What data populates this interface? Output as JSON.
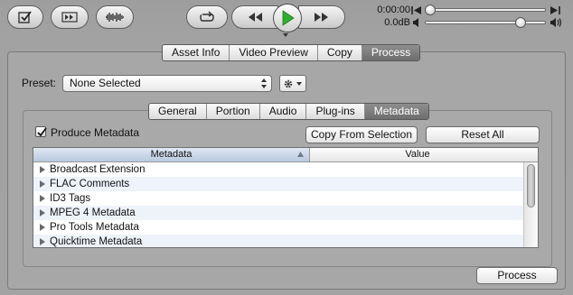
{
  "toolbar": {
    "buttons": [
      {
        "name": "checklist-icon"
      },
      {
        "name": "fast-forward-frames-icon"
      },
      {
        "name": "waveform-icon"
      }
    ],
    "transport": {
      "loop": "loop-icon",
      "rewind": "rewind-icon",
      "play": "play-icon",
      "forward": "fast-forward-icon"
    },
    "time_readout": "0:00:00",
    "gain_readout": "0.0dB",
    "time_position": 0.0,
    "volume_level": 0.82,
    "play_color": "#2fae2f"
  },
  "main_tabs": [
    {
      "label": "Asset Info",
      "active": false
    },
    {
      "label": "Video Preview",
      "active": false
    },
    {
      "label": "Copy",
      "active": false
    },
    {
      "label": "Process",
      "active": true
    }
  ],
  "preset": {
    "label": "Preset:",
    "value": "None Selected"
  },
  "sub_tabs": [
    {
      "label": "General",
      "active": false
    },
    {
      "label": "Portion",
      "active": false
    },
    {
      "label": "Audio",
      "active": false
    },
    {
      "label": "Plug-ins",
      "active": false
    },
    {
      "label": "Metadata",
      "active": true
    }
  ],
  "metadata": {
    "produce_label": "Produce Metadata",
    "produce_checked": true,
    "copy_button": "Copy From Selection",
    "reset_button": "Reset All",
    "columns": [
      "Metadata",
      "Value"
    ],
    "rows": [
      "Broadcast Extension",
      "FLAC Comments",
      "ID3 Tags",
      "MPEG 4 Metadata",
      "Pro Tools Metadata",
      "Quicktime Metadata"
    ]
  },
  "process_button": "Process"
}
